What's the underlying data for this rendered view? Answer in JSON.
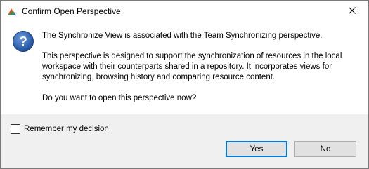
{
  "window": {
    "title": "Confirm Open Perspective"
  },
  "message": {
    "line1": "The Synchronize View is associated with the Team Synchronizing perspective.",
    "para2_line1": "This perspective is designed to support the synchronization of resources in the local",
    "para2_line2": "workspace with their counterparts shared in a repository. It incorporates views for",
    "para2_line3": "synchronizing, browsing history and comparing resource content.",
    "question": "Do you want to open this perspective now?"
  },
  "remember": {
    "label": "Remember my decision",
    "checked": false
  },
  "buttons": {
    "yes": "Yes",
    "no": "No"
  },
  "icons": {
    "app": "eclipse-app-icon",
    "question": "question-icon",
    "close": "close-icon"
  },
  "colors": {
    "accent": "#0078d7",
    "question_icon": "#2d5ea8"
  }
}
